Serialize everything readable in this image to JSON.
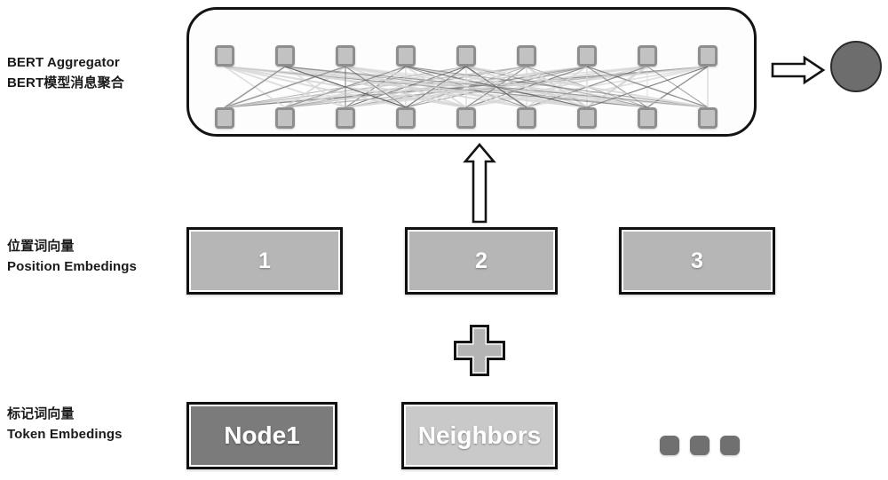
{
  "diagram": {
    "title_visible": false,
    "rows": {
      "aggregator": {
        "label_cn": "BERT模型消息聚合",
        "label_en": "BERT Aggregator",
        "node_count_top": 9,
        "node_count_bottom": 9,
        "output_arrow_icon": "right-block-arrow-icon",
        "output_node_color": "#6d6d6d"
      },
      "position": {
        "label_cn": "位置词向量",
        "label_en": "Position Embedings",
        "boxes": [
          {
            "text": "1",
            "fill": "#b6b6b6"
          },
          {
            "text": "2",
            "fill": "#b6b6b6"
          },
          {
            "text": "3",
            "fill": "#b6b6b6"
          }
        ]
      },
      "token": {
        "label_cn": "标记词向量",
        "label_en": "Token Embedings",
        "boxes": [
          {
            "text": "Node1",
            "fill": "#7b7b7b"
          },
          {
            "text": "Neighbors",
            "fill": "#c9c9c9"
          }
        ],
        "ellipsis_dots": 3
      }
    },
    "connectors": {
      "up_arrow_icon": "up-block-arrow-icon",
      "plus_icon": "plus-sign-icon"
    },
    "colors": {
      "outline": "#131313",
      "node_fill": "#c2c2c2",
      "node_border": "#8e8e8e",
      "edge_dark": "#5a5a5a",
      "edge_light": "#d6d6d6",
      "background": "#ffffff"
    }
  }
}
